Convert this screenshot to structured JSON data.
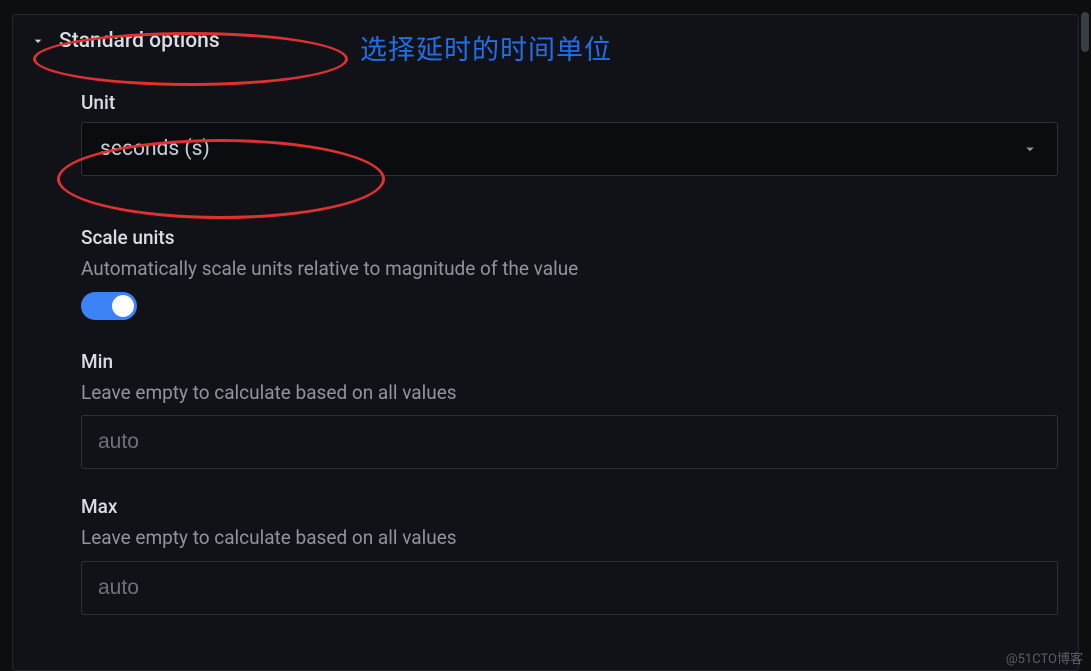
{
  "section": {
    "title": "Standard options"
  },
  "annotation": {
    "text": "选择延时的时间单位"
  },
  "unit_field": {
    "label": "Unit",
    "value": "seconds (s)"
  },
  "scale_units": {
    "label": "Scale units",
    "description": "Automatically scale units relative to magnitude of the value",
    "enabled": true
  },
  "min_field": {
    "label": "Min",
    "description": "Leave empty to calculate based on all values",
    "placeholder": "auto",
    "value": ""
  },
  "max_field": {
    "label": "Max",
    "description": "Leave empty to calculate based on all values",
    "placeholder": "auto",
    "value": ""
  },
  "watermark": "@51CTO博客"
}
